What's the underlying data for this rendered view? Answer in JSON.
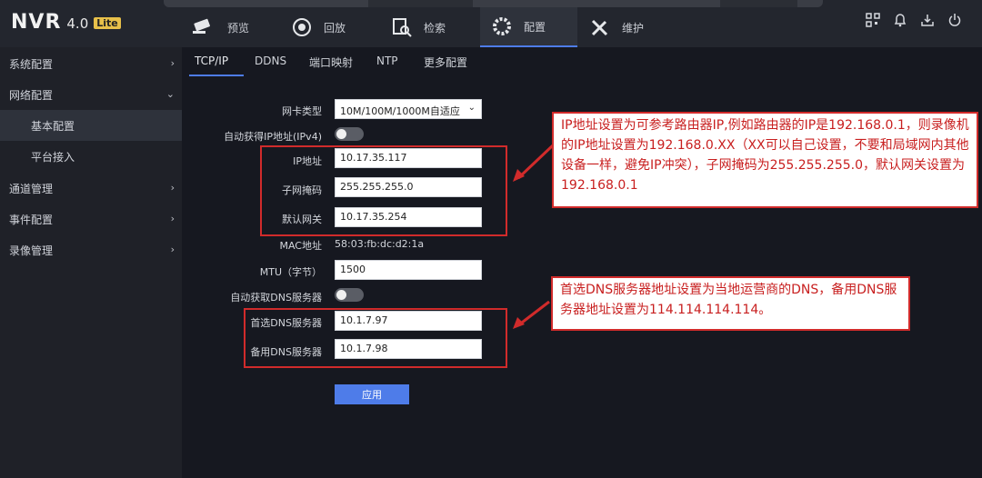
{
  "app": {
    "name": "NVR",
    "version": "4.0",
    "edition": "Lite"
  },
  "nav": {
    "tabs": [
      {
        "label": "预览",
        "icon": "camera-icon"
      },
      {
        "label": "回放",
        "icon": "playback-icon"
      },
      {
        "label": "检索",
        "icon": "search-doc-icon"
      },
      {
        "label": "配置",
        "icon": "gear-icon"
      },
      {
        "label": "维护",
        "icon": "tools-icon"
      }
    ],
    "active": "配置"
  },
  "sidebar": {
    "items": [
      {
        "label": "系统配置"
      },
      {
        "label": "网络配置"
      },
      {
        "label": "基本配置"
      },
      {
        "label": "平台接入"
      },
      {
        "label": "通道管理"
      },
      {
        "label": "事件配置"
      },
      {
        "label": "录像管理"
      }
    ]
  },
  "subtabs": [
    "TCP/IP",
    "DDNS",
    "端口映射",
    "NTP",
    "更多配置"
  ],
  "form": {
    "nic_type_label": "网卡类型",
    "nic_type_value": "10M/100M/1000M自适应",
    "auto_ip_label": "自动获得IP地址(IPv4)",
    "ip_label": "IP地址",
    "ip_value": "10.17.35.117",
    "mask_label": "子网掩码",
    "mask_value": "255.255.255.0",
    "gateway_label": "默认网关",
    "gateway_value": "10.17.35.254",
    "mac_label": "MAC地址",
    "mac_value": "58:03:fb:dc:d2:1a",
    "mtu_label": "MTU（字节）",
    "mtu_value": "1500",
    "auto_dns_label": "自动获取DNS服务器",
    "dns1_label": "首选DNS服务器",
    "dns1_value": "10.1.7.97",
    "dns2_label": "备用DNS服务器",
    "dns2_value": "10.1.7.98",
    "apply_label": "应用"
  },
  "annotations": {
    "ip_note": "IP地址设置为可参考路由器IP,例如路由器的IP是192.168.0.1，则录像机的IP地址设置为192.168.0.XX（XX可以自己设置，不要和局域网内其他设备一样，避免IP冲突），子网掩码为255.255.255.0，默认网关设置为192.168.0.1",
    "dns_note": "首选DNS服务器地址设置为当地运营商的DNS，备用DNS服务器地址设置为114.114.114.114。"
  },
  "colors": {
    "accent": "#4e7ce9",
    "annotation_red": "#d12b2b"
  }
}
